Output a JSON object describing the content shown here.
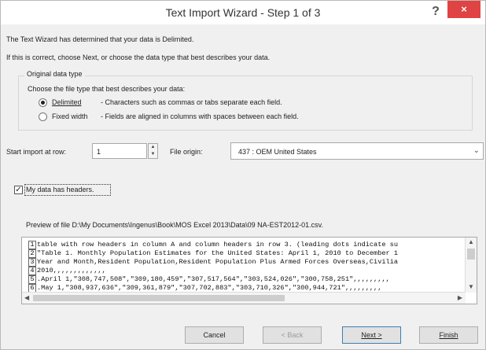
{
  "window": {
    "title": "Text Import Wizard - Step 1 of 3",
    "help": "?",
    "close": "×"
  },
  "intro": {
    "line1": "The Text Wizard has determined that your data is Delimited.",
    "line2": "If this is correct, choose Next, or choose the data type that best describes your data."
  },
  "group": {
    "label": "Original data type",
    "prompt": "Choose the file type that best describes your data:",
    "options": [
      {
        "label": "Delimited",
        "desc": "- Characters such as commas or tabs separate each field.",
        "selected": true
      },
      {
        "label": "Fixed width",
        "desc": "- Fields are aligned in columns with spaces between each field.",
        "selected": false
      }
    ]
  },
  "start_import": {
    "label": "Start import at row:",
    "value": "1"
  },
  "file_origin": {
    "label": "File origin:",
    "value": "437 : OEM United States"
  },
  "headers": {
    "label": "My data has headers.",
    "checked": true
  },
  "preview": {
    "label": "Preview of file D:\\My Documents\\Ingenus\\Book\\MOS Excel 2013\\Data\\09 NA-EST2012-01.csv.",
    "lines": [
      {
        "n": "1",
        "text": "table with row headers in column A and column headers in row 3. (leading dots indicate su"
      },
      {
        "n": "2",
        "text": "\"Table 1. Monthly Population Estimates for the United States: April 1, 2010 to December 1"
      },
      {
        "n": "3",
        "text": "Year and Month,Resident Population,Resident Population Plus Armed Forces Overseas,Civilia"
      },
      {
        "n": "4",
        "text": "2010,,,,,,,,,,,,,"
      },
      {
        "n": "5",
        "text": ".April 1,\"308,747,508\",\"309,180,459\",\"307,517,564\",\"303,524,026\",\"300,758,251\",,,,,,,,,"
      },
      {
        "n": "6",
        "text": ".May 1,\"308,937,636\",\"309,361,879\",\"307,702,883\",\"303,710,326\",\"300,944,721\",,,,,,,,,"
      }
    ]
  },
  "buttons": {
    "cancel": "Cancel",
    "back": "< Back",
    "next": "Next >",
    "finish": "Finish"
  }
}
